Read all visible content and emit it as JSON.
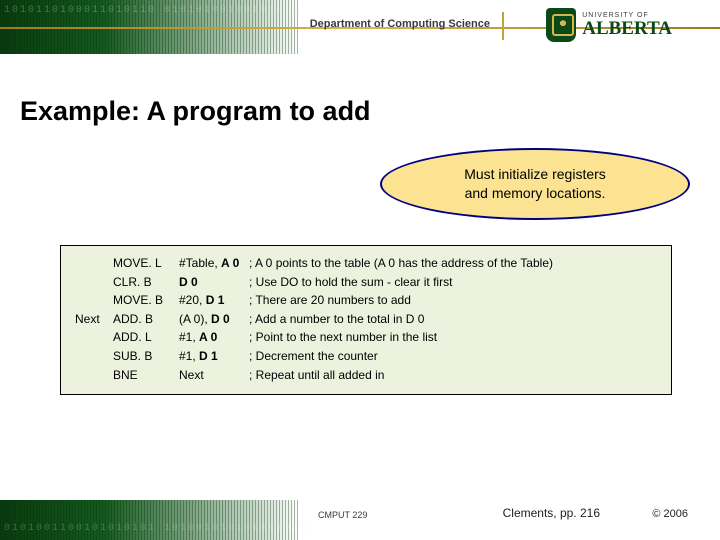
{
  "header": {
    "department": "Department of Computing Science",
    "university_top": "UNIVERSITY OF",
    "university_name": "ALBERTA"
  },
  "title": "Example: A program to add",
  "callout": {
    "line1": "Must initialize registers",
    "line2": "and memory locations."
  },
  "code": {
    "rows": [
      {
        "label": "",
        "op": "MOVE. L",
        "arg_pre": "#Table, ",
        "arg_bold": "A 0",
        "comment": "; A 0 points to the table (A 0 has the address of the Table)"
      },
      {
        "label": "",
        "op": "CLR. B",
        "arg_pre": "",
        "arg_bold": "D 0",
        "comment": "; Use DO to hold the sum - clear it first"
      },
      {
        "label": "",
        "op": "MOVE. B",
        "arg_pre": "#20, ",
        "arg_bold": "D 1",
        "comment": "; There are 20 numbers to add"
      },
      {
        "label": "Next",
        "op": "ADD. B",
        "arg_pre": "(A 0), ",
        "arg_bold": "D 0",
        "comment": "; Add a number to the total in D 0"
      },
      {
        "label": "",
        "op": "ADD. L",
        "arg_pre": "#1, ",
        "arg_bold": "A 0",
        "comment": "; Point to the next number in the list"
      },
      {
        "label": "",
        "op": "SUB. B",
        "arg_pre": "#1, ",
        "arg_bold": "D 1",
        "comment": "; Decrement the counter"
      },
      {
        "label": "",
        "op": "BNE",
        "arg_pre": "Next",
        "arg_bold": "",
        "comment": "; Repeat until all added in"
      }
    ]
  },
  "footer": {
    "course": "CMPUT 229",
    "page_ref": "Clements, pp. 216",
    "copyright": "© 2006"
  }
}
